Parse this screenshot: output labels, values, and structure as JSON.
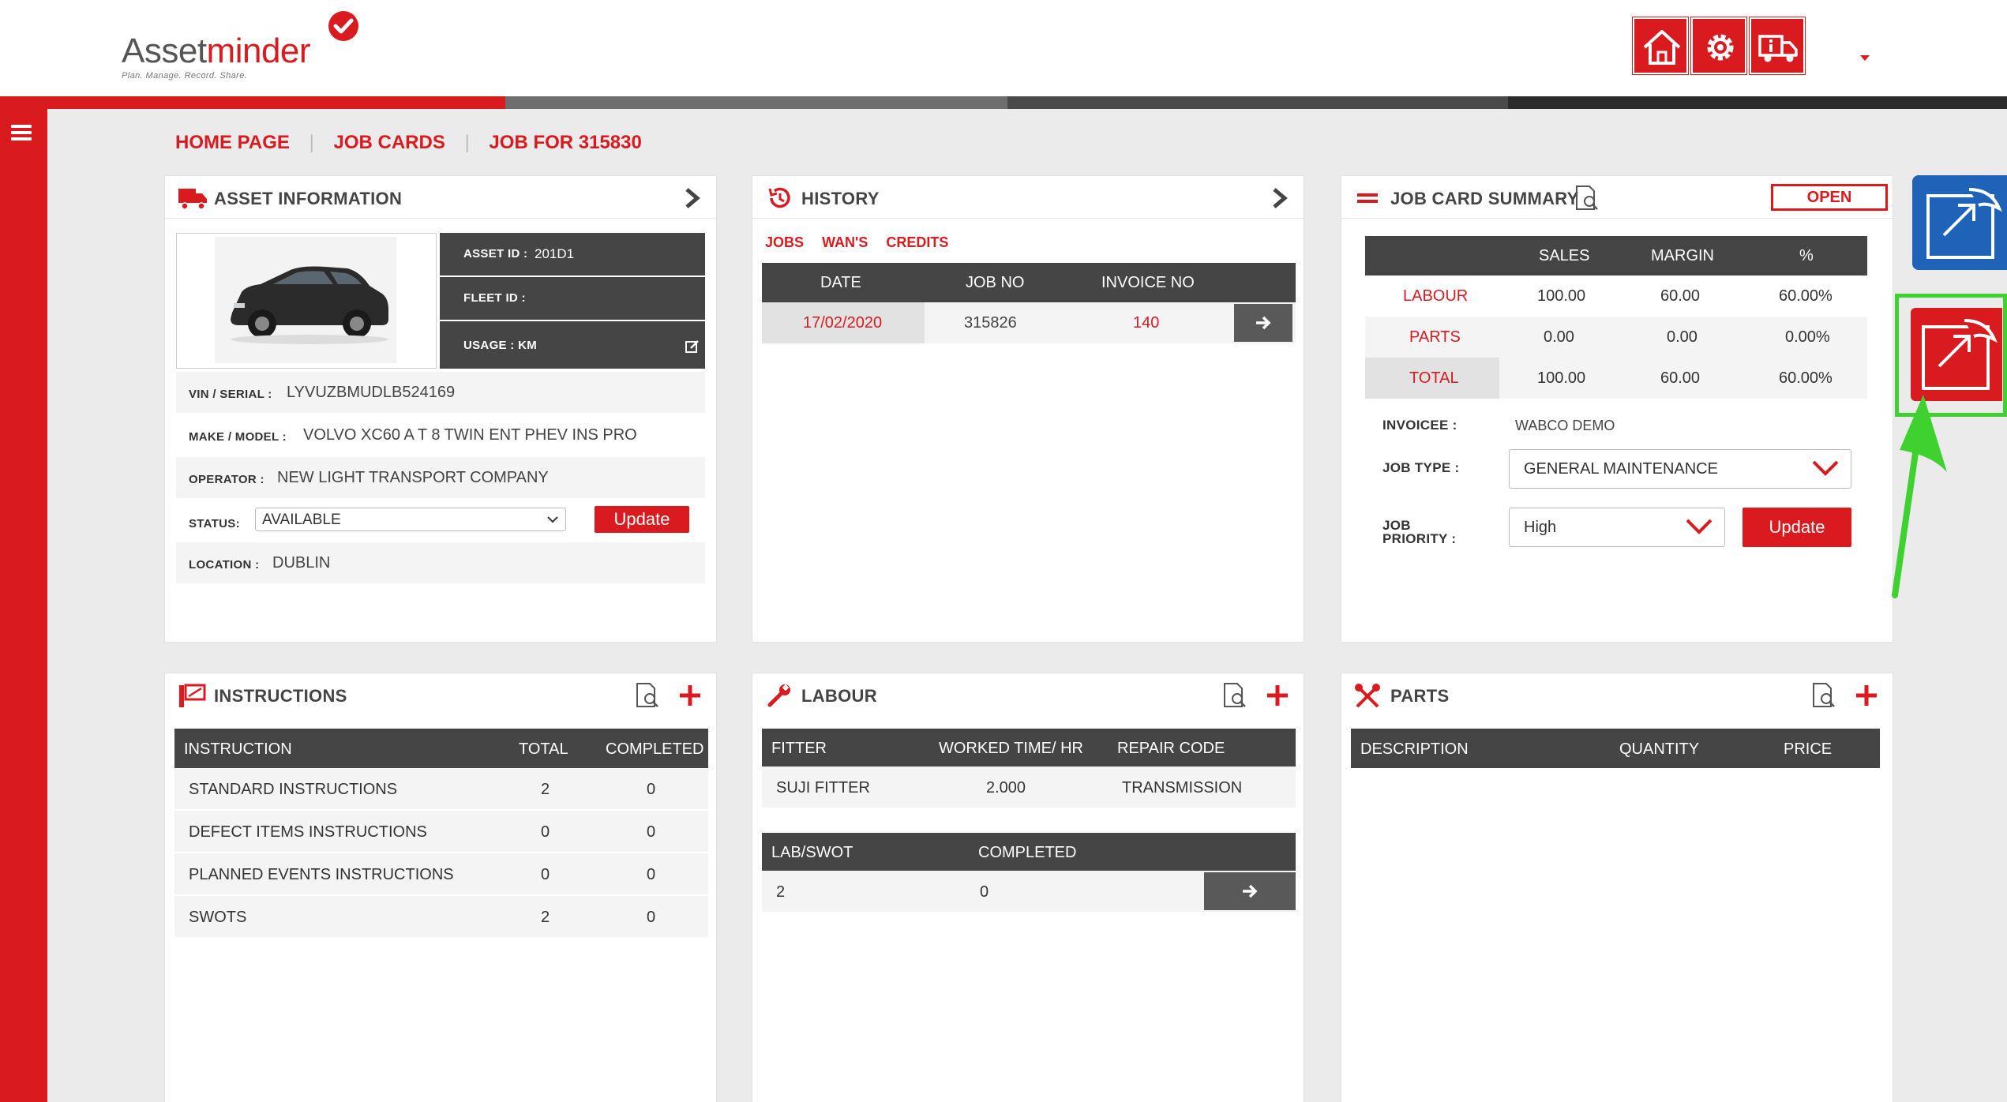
{
  "brand": {
    "name_part1": "Asset",
    "name_part2": "minder",
    "tagline": "Plan. Manage. Record. Share.",
    "primary_color": "#d91a1f",
    "accent_blue": "#1e63b8",
    "highlight_green": "#3fd12f"
  },
  "header_icons": [
    "home-icon",
    "settings-gear-icon",
    "truck-info-icon"
  ],
  "breadcrumb": [
    "HOME PAGE",
    "JOB CARDS",
    "JOB FOR 315830"
  ],
  "asset_info": {
    "title": "ASSET INFORMATION",
    "asset_id_label": "ASSET ID :",
    "asset_id": "201D1",
    "fleet_id_label": "FLEET ID :",
    "fleet_id": "",
    "usage_label": "USAGE : KM",
    "vin_label": "VIN / SERIAL :",
    "vin": "LYVUZBMUDLB524169",
    "make_label": "MAKE / MODEL :",
    "make": "VOLVO XC60 A T 8 TWIN ENT PHEV INS PRO",
    "operator_label": "OPERATOR :",
    "operator": "NEW LIGHT TRANSPORT COMPANY",
    "status_label": "STATUS:",
    "status": "AVAILABLE",
    "update_label": "Update",
    "location_label": "LOCATION :",
    "location": "DUBLIN"
  },
  "history": {
    "title": "HISTORY",
    "tabs": [
      "JOBS",
      "WAN'S",
      "CREDITS"
    ],
    "columns": [
      "DATE",
      "JOB NO",
      "INVOICE NO"
    ],
    "rows": [
      {
        "date": "17/02/2020",
        "job_no": "315826",
        "invoice_no": "140"
      }
    ]
  },
  "job_summary": {
    "title": "JOB CARD SUMMARY",
    "status_badge": "OPEN",
    "columns": [
      "SALES",
      "MARGIN",
      "%"
    ],
    "rows": [
      {
        "label": "LABOUR",
        "sales": "100.00",
        "margin": "60.00",
        "pct": "60.00%"
      },
      {
        "label": "PARTS",
        "sales": "0.00",
        "margin": "0.00",
        "pct": "0.00%"
      },
      {
        "label": "TOTAL",
        "sales": "100.00",
        "margin": "60.00",
        "pct": "60.00%"
      }
    ],
    "invoicee_label": "INVOICEE :",
    "invoicee": "WABCO DEMO",
    "job_type_label": "JOB TYPE :",
    "job_type": "GENERAL MAINTENANCE",
    "job_priority_label_1": "JOB",
    "job_priority_label_2": "PRIORITY :",
    "job_priority": "High",
    "update_label": "Update"
  },
  "instructions": {
    "title": "INSTRUCTIONS",
    "columns": [
      "INSTRUCTION",
      "TOTAL",
      "COMPLETED"
    ],
    "rows": [
      {
        "name": "STANDARD INSTRUCTIONS",
        "total": "2",
        "completed": "0"
      },
      {
        "name": "DEFECT ITEMS INSTRUCTIONS",
        "total": "0",
        "completed": "0"
      },
      {
        "name": "PLANNED EVENTS INSTRUCTIONS",
        "total": "0",
        "completed": "0"
      },
      {
        "name": "SWOTS",
        "total": "2",
        "completed": "0"
      }
    ]
  },
  "labour": {
    "title": "LABOUR",
    "columns": [
      "FITTER",
      "WORKED TIME/ HR",
      "REPAIR CODE"
    ],
    "rows": [
      {
        "fitter": "SUJI FITTER",
        "time": "2.000",
        "code": "TRANSMISSION"
      }
    ],
    "swot_columns": [
      "LAB/SWOT",
      "COMPLETED"
    ],
    "swot_rows": [
      {
        "lab": "2",
        "completed": "0"
      }
    ]
  },
  "parts": {
    "title": "PARTS",
    "columns": [
      "DESCRIPTION",
      "QUANTITY",
      "PRICE"
    ]
  }
}
